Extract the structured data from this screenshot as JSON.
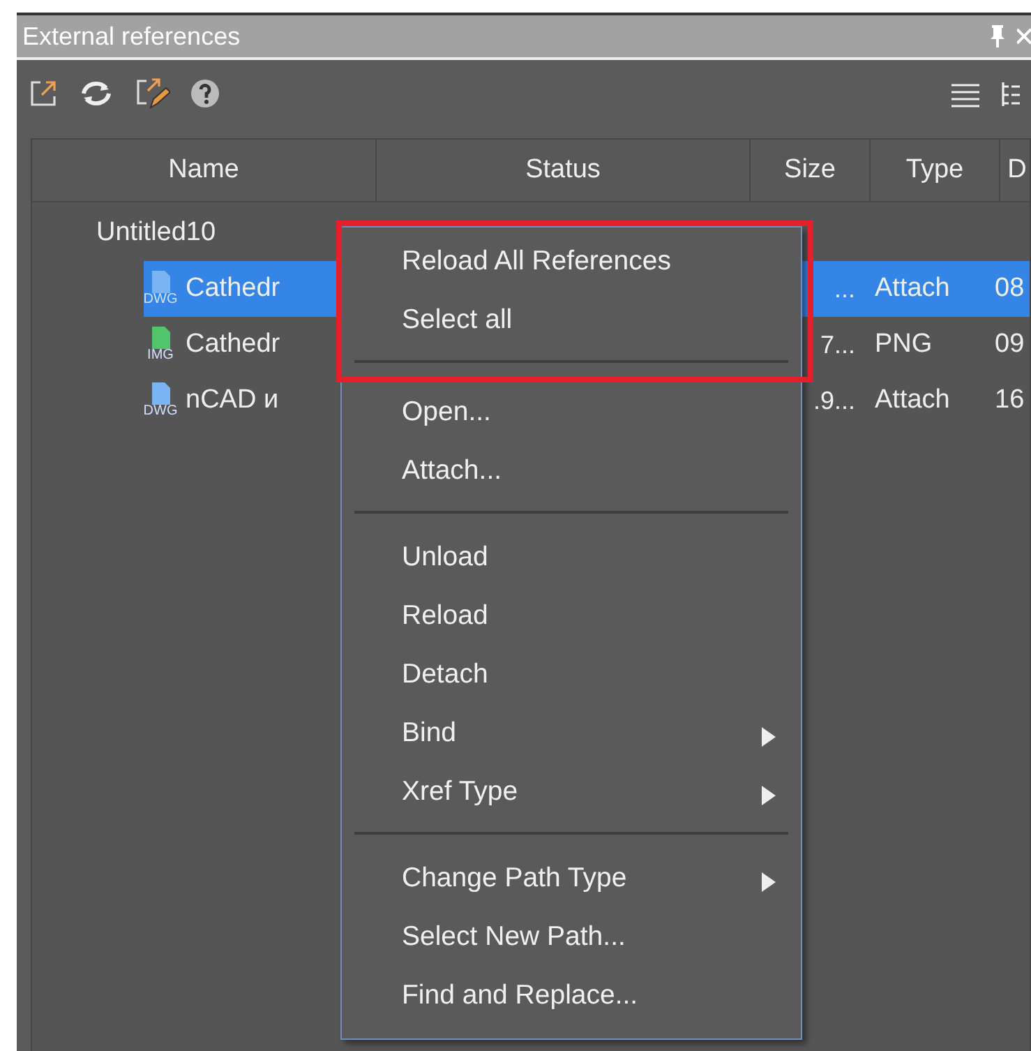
{
  "panel": {
    "title": "External references"
  },
  "table": {
    "columns": [
      "Name",
      "Status",
      "Size",
      "Type",
      "D"
    ],
    "tree": [
      {
        "name": "Untitled10",
        "children": [
          {
            "name": "Cathedr",
            "kind": "dwg",
            "icon_label": "DWG",
            "size": "...",
            "type": "Attach",
            "date": "08",
            "selected": true
          },
          {
            "name": "Cathedr",
            "kind": "img",
            "icon_label": "IMG",
            "size": "7...",
            "type": "PNG",
            "date": "09",
            "selected": false
          },
          {
            "name": "nCAD и",
            "kind": "dwg",
            "icon_label": "DWG",
            "size": ".9...",
            "type": "Attach",
            "date": "16",
            "selected": false
          }
        ]
      }
    ]
  },
  "context_menu": {
    "highlighted_items": [
      {
        "kind": "item",
        "label": "Reload All References",
        "submenu": false
      },
      {
        "kind": "item",
        "label": "Select all",
        "submenu": false
      },
      {
        "kind": "separator"
      }
    ],
    "items": [
      {
        "kind": "item",
        "label": "Open...",
        "submenu": false
      },
      {
        "kind": "item",
        "label": "Attach...",
        "submenu": false
      },
      {
        "kind": "separator"
      },
      {
        "kind": "item",
        "label": "Unload",
        "submenu": false
      },
      {
        "kind": "item",
        "label": "Reload",
        "submenu": false
      },
      {
        "kind": "item",
        "label": "Detach",
        "submenu": false
      },
      {
        "kind": "item",
        "label": "Bind",
        "submenu": true
      },
      {
        "kind": "item",
        "label": "Xref Type",
        "submenu": true
      },
      {
        "kind": "separator"
      },
      {
        "kind": "item",
        "label": "Change Path Type",
        "submenu": true
      },
      {
        "kind": "item",
        "label": "Select New Path...",
        "submenu": false
      },
      {
        "kind": "item",
        "label": "Find and Replace...",
        "submenu": false
      }
    ]
  }
}
